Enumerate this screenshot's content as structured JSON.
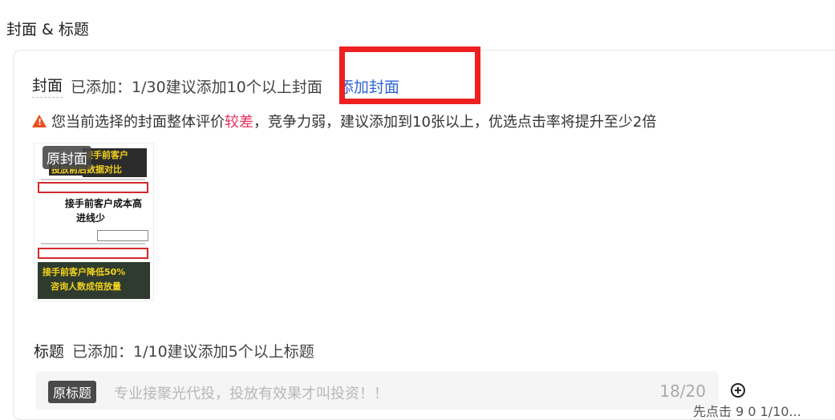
{
  "section": {
    "title": "封面 & 标题"
  },
  "cover": {
    "label": "封面",
    "status": "已添加：1/30建议添加10个以上封面",
    "add_link": "添加封面",
    "warning_prefix": "您当前选择的封面整体评价",
    "warning_rating": "较差",
    "warning_suffix": "，竞争力弱，建议添加到10张以上，优选点击率将提升至少2倍",
    "thumbnail": {
      "badge": "原封面",
      "text_top_1": "接手前客户",
      "text_top_2": "投放前后数据对比",
      "text_mid_1": "接手前客户成本高",
      "text_mid_2": "进线少",
      "text_bottom_1": "接手前客户降低50%",
      "text_bottom_2": "咨询人数成倍放量"
    }
  },
  "title_section": {
    "label": "标题",
    "status": "已添加：1/10建议添加5个以上标题",
    "input": {
      "badge": "原标题",
      "placeholder": "专业接聚光代投，投放有效果才叫投资！！",
      "count": "18/20"
    },
    "clipped_text": "先点击 9 0 1/10..."
  },
  "colors": {
    "link": "#2e63d8",
    "warning": "#e8501d",
    "bad_rating": "#e8315f",
    "highlight_box": "#ee2020"
  }
}
